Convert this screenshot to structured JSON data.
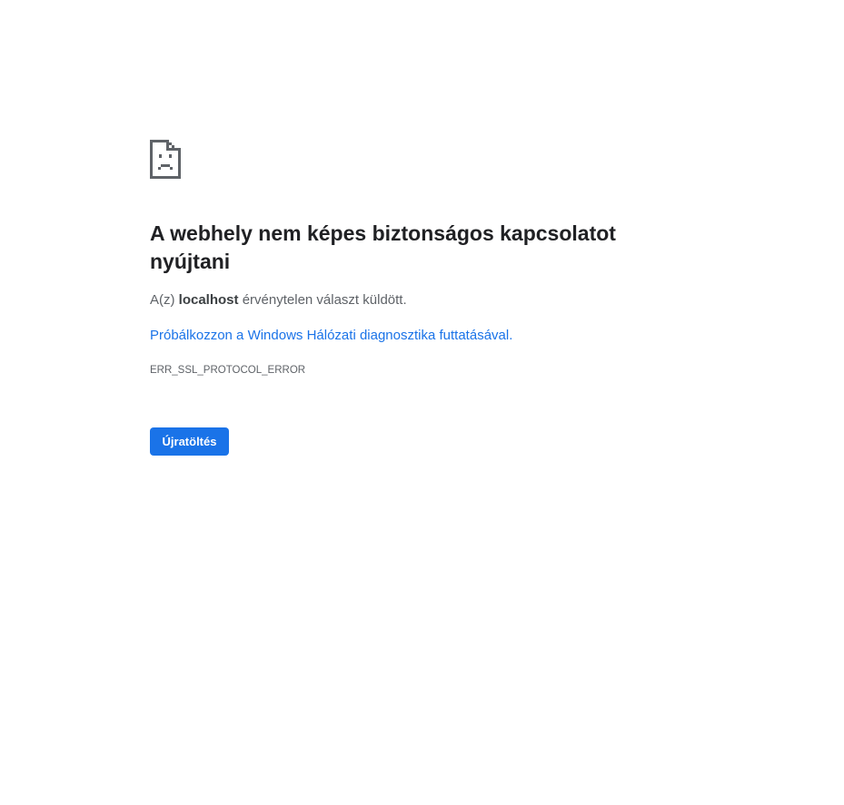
{
  "icon": "sad-page-icon",
  "heading": "A webhely nem képes biztonságos kapcsolatot nyújtani",
  "summary": {
    "prefix": "A(z) ",
    "host": "localhost",
    "suffix": " érvénytelen választ küldött."
  },
  "suggestion": {
    "link_text": "Próbálkozzon a Windows Hálózati diagnosztika futtatásával",
    "trailing": "."
  },
  "error_code": "ERR_SSL_PROTOCOL_ERROR",
  "reload_label": "Újratöltés",
  "colors": {
    "accent": "#1a73e8",
    "heading": "#202124",
    "body_text": "#5f6368"
  }
}
